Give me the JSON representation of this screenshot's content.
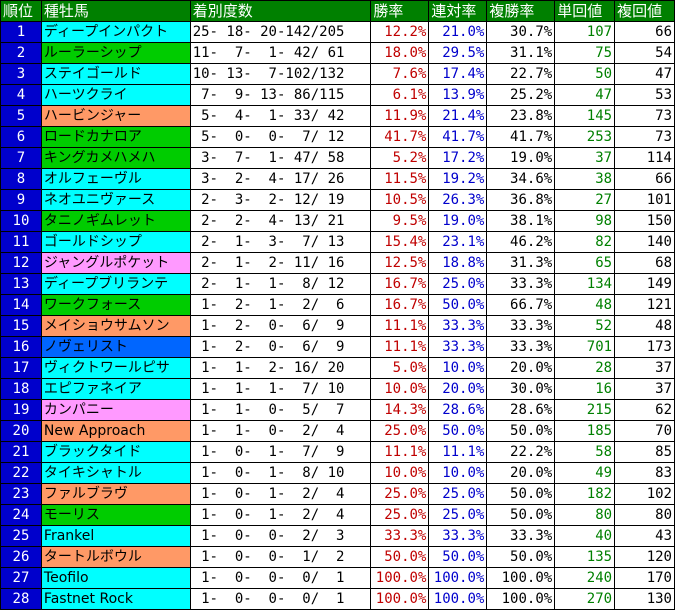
{
  "headers": {
    "rank": "順位",
    "sire": "種牡馬",
    "record": "着別度数",
    "win_rate": "勝率",
    "place2_rate": "連対率",
    "place3_rate": "複勝率",
    "win_return": "単回値",
    "place_return": "複回値"
  },
  "colors": {
    "header_bg": "#008000",
    "rank_bg": "#0000cc",
    "cyan": "#00ffff",
    "green": "#00cc00",
    "orange": "#ff9966",
    "pink": "#ff99ff",
    "blue": "#0066ff",
    "win_rate_text": "#c00000",
    "place2_rate_text": "#0000cc",
    "win_return_text": "#008000"
  },
  "rows": [
    {
      "rank": "1",
      "sire": "ディープインパクト",
      "color": "cyan",
      "record": "25- 18- 20-142/205",
      "win_rate": "12.2%",
      "place2_rate": "21.0%",
      "place3_rate": "30.7%",
      "win_return": "107",
      "place_return": "66"
    },
    {
      "rank": "2",
      "sire": "ルーラーシップ",
      "color": "green",
      "record": "11-  7-  1- 42/ 61",
      "win_rate": "18.0%",
      "place2_rate": "29.5%",
      "place3_rate": "31.1%",
      "win_return": "75",
      "place_return": "54"
    },
    {
      "rank": "3",
      "sire": "ステイゴールド",
      "color": "cyan",
      "record": "10- 13-  7-102/132",
      "win_rate": "7.6%",
      "place2_rate": "17.4%",
      "place3_rate": "22.7%",
      "win_return": "50",
      "place_return": "47"
    },
    {
      "rank": "4",
      "sire": "ハーツクライ",
      "color": "cyan",
      "record": " 7-  9- 13- 86/115",
      "win_rate": "6.1%",
      "place2_rate": "13.9%",
      "place3_rate": "25.2%",
      "win_return": "47",
      "place_return": "53"
    },
    {
      "rank": "5",
      "sire": "ハービンジャー",
      "color": "orange",
      "record": " 5-  4-  1- 33/ 42",
      "win_rate": "11.9%",
      "place2_rate": "21.4%",
      "place3_rate": "23.8%",
      "win_return": "145",
      "place_return": "73"
    },
    {
      "rank": "6",
      "sire": "ロードカナロア",
      "color": "green",
      "record": " 5-  0-  0-  7/ 12",
      "win_rate": "41.7%",
      "place2_rate": "41.7%",
      "place3_rate": "41.7%",
      "win_return": "253",
      "place_return": "73"
    },
    {
      "rank": "7",
      "sire": "キングカメハメハ",
      "color": "green",
      "record": " 3-  7-  1- 47/ 58",
      "win_rate": "5.2%",
      "place2_rate": "17.2%",
      "place3_rate": "19.0%",
      "win_return": "37",
      "place_return": "114"
    },
    {
      "rank": "8",
      "sire": "オルフェーヴル",
      "color": "cyan",
      "record": " 3-  2-  4- 17/ 26",
      "win_rate": "11.5%",
      "place2_rate": "19.2%",
      "place3_rate": "34.6%",
      "win_return": "38",
      "place_return": "66"
    },
    {
      "rank": "9",
      "sire": "ネオユニヴァース",
      "color": "cyan",
      "record": " 2-  3-  2- 12/ 19",
      "win_rate": "10.5%",
      "place2_rate": "26.3%",
      "place3_rate": "36.8%",
      "win_return": "27",
      "place_return": "101"
    },
    {
      "rank": "10",
      "sire": "タニノギムレット",
      "color": "green",
      "record": " 2-  2-  4- 13/ 21",
      "win_rate": "9.5%",
      "place2_rate": "19.0%",
      "place3_rate": "38.1%",
      "win_return": "98",
      "place_return": "150"
    },
    {
      "rank": "11",
      "sire": "ゴールドシップ",
      "color": "cyan",
      "record": " 2-  1-  3-  7/ 13",
      "win_rate": "15.4%",
      "place2_rate": "23.1%",
      "place3_rate": "46.2%",
      "win_return": "82",
      "place_return": "140"
    },
    {
      "rank": "12",
      "sire": "ジャングルポケット",
      "color": "pink",
      "record": " 2-  1-  2- 11/ 16",
      "win_rate": "12.5%",
      "place2_rate": "18.8%",
      "place3_rate": "31.3%",
      "win_return": "65",
      "place_return": "68"
    },
    {
      "rank": "13",
      "sire": "ディープブリランテ",
      "color": "cyan",
      "record": " 2-  1-  1-  8/ 12",
      "win_rate": "16.7%",
      "place2_rate": "25.0%",
      "place3_rate": "33.3%",
      "win_return": "134",
      "place_return": "149"
    },
    {
      "rank": "14",
      "sire": "ワークフォース",
      "color": "green",
      "record": " 1-  2-  1-  2/  6",
      "win_rate": "16.7%",
      "place2_rate": "50.0%",
      "place3_rate": "66.7%",
      "win_return": "48",
      "place_return": "121"
    },
    {
      "rank": "15",
      "sire": "メイショウサムソン",
      "color": "orange",
      "record": " 1-  2-  0-  6/  9",
      "win_rate": "11.1%",
      "place2_rate": "33.3%",
      "place3_rate": "33.3%",
      "win_return": "52",
      "place_return": "48"
    },
    {
      "rank": "16",
      "sire": "ノヴェリスト",
      "color": "blue",
      "record": " 1-  2-  0-  6/  9",
      "win_rate": "11.1%",
      "place2_rate": "33.3%",
      "place3_rate": "33.3%",
      "win_return": "701",
      "place_return": "173"
    },
    {
      "rank": "17",
      "sire": "ヴィクトワールピサ",
      "color": "cyan",
      "record": " 1-  1-  2- 16/ 20",
      "win_rate": "5.0%",
      "place2_rate": "10.0%",
      "place3_rate": "20.0%",
      "win_return": "28",
      "place_return": "37"
    },
    {
      "rank": "18",
      "sire": "エピファネイア",
      "color": "cyan",
      "record": " 1-  1-  1-  7/ 10",
      "win_rate": "10.0%",
      "place2_rate": "20.0%",
      "place3_rate": "30.0%",
      "win_return": "16",
      "place_return": "37"
    },
    {
      "rank": "19",
      "sire": "カンパニー",
      "color": "pink",
      "record": " 1-  1-  0-  5/  7",
      "win_rate": "14.3%",
      "place2_rate": "28.6%",
      "place3_rate": "28.6%",
      "win_return": "215",
      "place_return": "62"
    },
    {
      "rank": "20",
      "sire": "New Approach",
      "color": "orange",
      "record": " 1-  1-  0-  2/  4",
      "win_rate": "25.0%",
      "place2_rate": "50.0%",
      "place3_rate": "50.0%",
      "win_return": "185",
      "place_return": "70"
    },
    {
      "rank": "21",
      "sire": "ブラックタイド",
      "color": "cyan",
      "record": " 1-  0-  1-  7/  9",
      "win_rate": "11.1%",
      "place2_rate": "11.1%",
      "place3_rate": "22.2%",
      "win_return": "58",
      "place_return": "85"
    },
    {
      "rank": "22",
      "sire": "タイキシャトル",
      "color": "cyan",
      "record": " 1-  0-  1-  8/ 10",
      "win_rate": "10.0%",
      "place2_rate": "10.0%",
      "place3_rate": "20.0%",
      "win_return": "49",
      "place_return": "83"
    },
    {
      "rank": "23",
      "sire": "ファルブラヴ",
      "color": "orange",
      "record": " 1-  0-  1-  2/  4",
      "win_rate": "25.0%",
      "place2_rate": "25.0%",
      "place3_rate": "50.0%",
      "win_return": "182",
      "place_return": "102"
    },
    {
      "rank": "24",
      "sire": "モーリス",
      "color": "green",
      "record": " 1-  0-  1-  2/  4",
      "win_rate": "25.0%",
      "place2_rate": "25.0%",
      "place3_rate": "50.0%",
      "win_return": "80",
      "place_return": "80"
    },
    {
      "rank": "25",
      "sire": "Frankel",
      "color": "cyan",
      "record": " 1-  0-  0-  2/  3",
      "win_rate": "33.3%",
      "place2_rate": "33.3%",
      "place3_rate": "33.3%",
      "win_return": "40",
      "place_return": "43"
    },
    {
      "rank": "26",
      "sire": "タートルボウル",
      "color": "orange",
      "record": " 1-  0-  0-  1/  2",
      "win_rate": "50.0%",
      "place2_rate": "50.0%",
      "place3_rate": "50.0%",
      "win_return": "135",
      "place_return": "120"
    },
    {
      "rank": "27",
      "sire": "Teofilo",
      "color": "cyan",
      "record": " 1-  0-  0-  0/  1",
      "win_rate": "100.0%",
      "place2_rate": "100.0%",
      "place3_rate": "100.0%",
      "win_return": "240",
      "place_return": "170"
    },
    {
      "rank": "28",
      "sire": "Fastnet Rock",
      "color": "cyan",
      "record": " 1-  0-  0-  0/  1",
      "win_rate": "100.0%",
      "place2_rate": "100.0%",
      "place3_rate": "100.0%",
      "win_return": "270",
      "place_return": "130"
    }
  ]
}
